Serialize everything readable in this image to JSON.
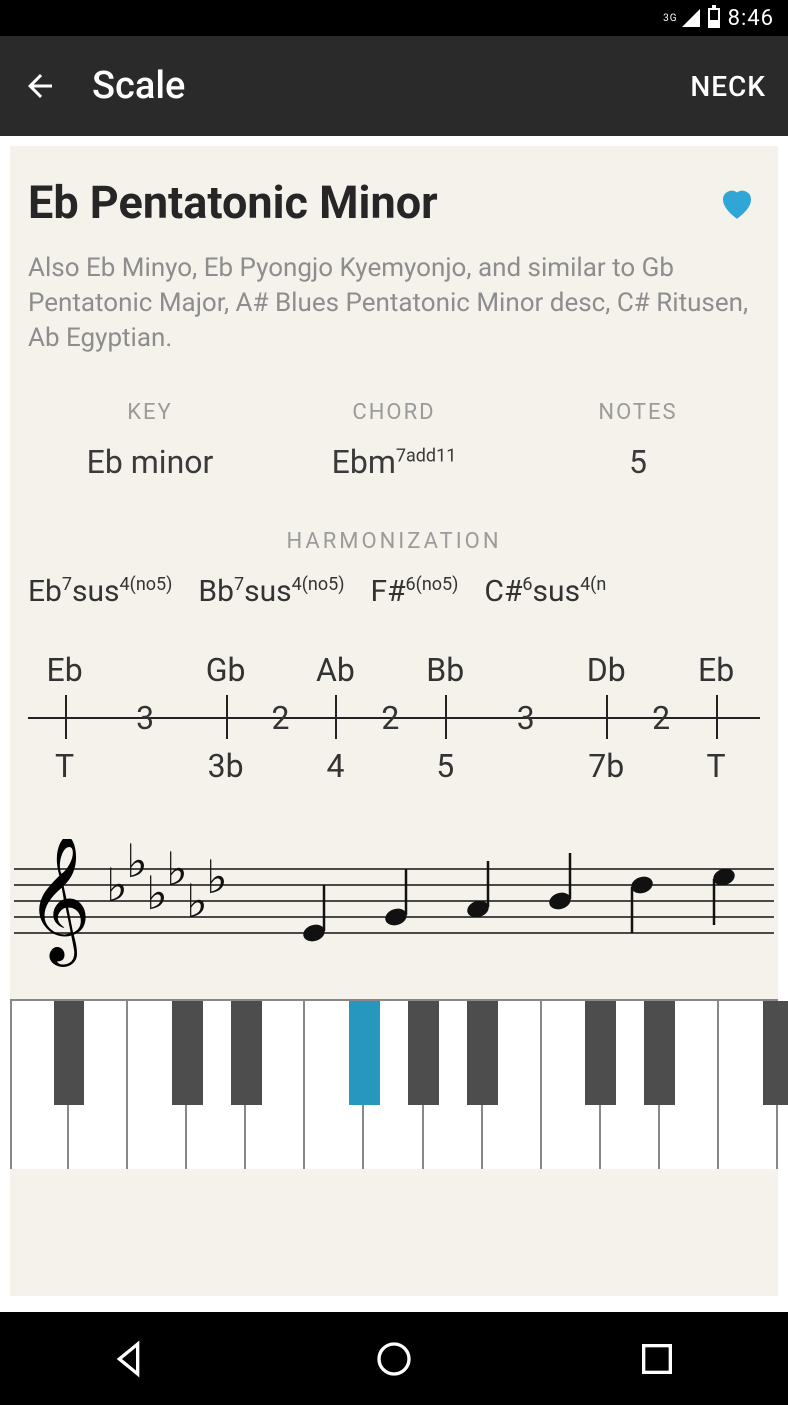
{
  "status": {
    "time": "8:46",
    "network": "3G"
  },
  "appbar": {
    "title": "Scale",
    "action": "NECK"
  },
  "scale": {
    "title": "Eb Pentatonic Minor",
    "description": "Also Eb Minyo, Eb Pyongjo Kyemyonjo, and similar to Gb Pentatonic Major, A# Blues Pentatonic Minor desc, C# Ritusen, Ab Egyptian.",
    "favorite": true
  },
  "info": {
    "key_label": "KEY",
    "key_value": "Eb minor",
    "chord_label": "CHORD",
    "chord_base": "Ebm",
    "chord_sup": "7add11",
    "notes_label": "NOTES",
    "notes_value": "5"
  },
  "harmonization": {
    "label": "HARMONIZATION",
    "items": [
      {
        "base": "Eb",
        "sup1": "7",
        "mid": "sus",
        "sup2": "4(no5)"
      },
      {
        "base": "Bb",
        "sup1": "7",
        "mid": "sus",
        "sup2": "4(no5)"
      },
      {
        "base": "F#",
        "sup1": "6(no5)",
        "mid": "",
        "sup2": ""
      },
      {
        "base": "C#",
        "sup1": "6",
        "mid": "sus",
        "sup2": "4(n"
      }
    ]
  },
  "chart_data": {
    "type": "table",
    "title": "Scale intervals",
    "notes": [
      "Eb",
      "Gb",
      "Ab",
      "Bb",
      "Db",
      "Eb"
    ],
    "degrees": [
      "T",
      "3b",
      "4",
      "5",
      "7b",
      "T"
    ],
    "semitone_gaps": [
      3,
      2,
      2,
      3,
      2
    ],
    "positions_pct": [
      5,
      27,
      42,
      57,
      79,
      94
    ]
  },
  "staff": {
    "key_signature_flats": 6,
    "note_names": [
      "Eb",
      "Gb",
      "Ab",
      "Bb",
      "Db",
      "Eb"
    ]
  },
  "keyboard": {
    "white_count": 13,
    "black_pattern": [
      0,
      1,
      1,
      0,
      1,
      1,
      1,
      0,
      1,
      1,
      0,
      1,
      1,
      1
    ],
    "highlighted_black_indices": [
      3,
      9
    ]
  }
}
